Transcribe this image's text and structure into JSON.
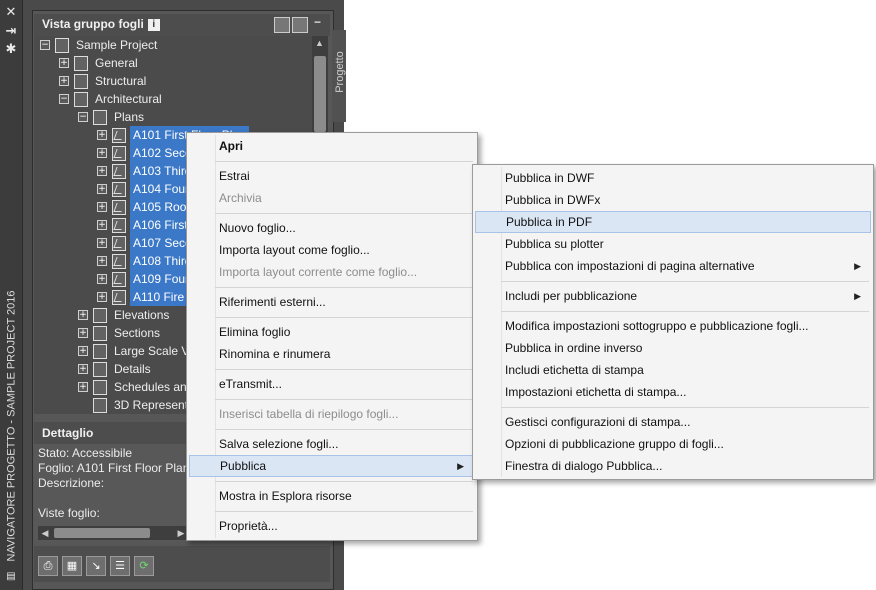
{
  "palette": {
    "vertical_title": "NAVIGATORE PROGETTO - SAMPLE PROJECT 2016",
    "side_tab": "Progetto",
    "title_buttons": [
      "close-icon",
      "autohide-icon",
      "properties-icon"
    ]
  },
  "sheet_set": {
    "header": "Vista gruppo fogli",
    "info_badge": "i",
    "tree": [
      {
        "label": "Sample Project",
        "level": 0,
        "expander": "−",
        "icon": "sheet-set-icon"
      },
      {
        "label": "General",
        "level": 1,
        "expander": "+",
        "icon": "subset-icon"
      },
      {
        "label": "Structural",
        "level": 1,
        "expander": "+",
        "icon": "subset-icon"
      },
      {
        "label": "Architectural",
        "level": 1,
        "expander": "−",
        "icon": "subset-icon"
      },
      {
        "label": "Plans",
        "level": 2,
        "expander": "−",
        "icon": "subset-icon"
      },
      {
        "label": "A101 First Floor Plan",
        "level": 3,
        "expander": "+",
        "icon": "sheet-icon",
        "selected": true
      },
      {
        "label": "A102 Seco",
        "level": 3,
        "expander": "+",
        "icon": "sheet-icon",
        "selected": true
      },
      {
        "label": "A103 Third",
        "level": 3,
        "expander": "+",
        "icon": "sheet-icon",
        "selected": true
      },
      {
        "label": "A104 Four",
        "level": 3,
        "expander": "+",
        "icon": "sheet-icon",
        "selected": true
      },
      {
        "label": "A105 Root",
        "level": 3,
        "expander": "+",
        "icon": "sheet-icon",
        "selected": true
      },
      {
        "label": "A106 First",
        "level": 3,
        "expander": "+",
        "icon": "sheet-icon",
        "selected": true
      },
      {
        "label": "A107 Seco",
        "level": 3,
        "expander": "+",
        "icon": "sheet-icon",
        "selected": true
      },
      {
        "label": "A108 Third",
        "level": 3,
        "expander": "+",
        "icon": "sheet-icon",
        "selected": true
      },
      {
        "label": "A109 Four",
        "level": 3,
        "expander": "+",
        "icon": "sheet-icon",
        "selected": true
      },
      {
        "label": "A110 Fire",
        "level": 3,
        "expander": "+",
        "icon": "sheet-icon",
        "selected": true
      },
      {
        "label": "Elevations",
        "level": 2,
        "expander": "+",
        "icon": "subset-icon"
      },
      {
        "label": "Sections",
        "level": 2,
        "expander": "+",
        "icon": "subset-icon"
      },
      {
        "label": "Large Scale Vi",
        "level": 2,
        "expander": "+",
        "icon": "subset-icon"
      },
      {
        "label": "Details",
        "level": 2,
        "expander": "+",
        "icon": "subset-icon"
      },
      {
        "label": "Schedules and",
        "level": 2,
        "expander": "+",
        "icon": "subset-icon"
      },
      {
        "label": "3D Representa",
        "level": 2,
        "expander": "",
        "icon": "subset-icon"
      }
    ]
  },
  "detail": {
    "header": "Dettaglio",
    "lines": [
      "Stato: Accessibile",
      "Foglio: A101 First Floor Plan",
      "Descrizione:",
      "",
      "Viste foglio:"
    ]
  },
  "bottom_toolbar": [
    "publish-icon",
    "new-sheet-icon",
    "views-icon",
    "list-icon",
    "refresh-icon"
  ],
  "context_menu": {
    "items": [
      {
        "label": "Apri",
        "bold": true
      },
      {
        "sep": true
      },
      {
        "label": "Estrai"
      },
      {
        "label": "Archivia",
        "disabled": true
      },
      {
        "sep": true
      },
      {
        "label": "Nuovo foglio..."
      },
      {
        "label": "Importa layout come foglio..."
      },
      {
        "label": "Importa layout corrente come foglio...",
        "disabled": true
      },
      {
        "sep": true
      },
      {
        "label": "Riferimenti esterni..."
      },
      {
        "sep": true
      },
      {
        "label": "Elimina foglio"
      },
      {
        "label": "Rinomina e rinumera"
      },
      {
        "sep": true
      },
      {
        "label": "eTransmit..."
      },
      {
        "sep": true
      },
      {
        "label": "Inserisci tabella di riepilogo fogli...",
        "disabled": true
      },
      {
        "sep": true
      },
      {
        "label": "Salva selezione fogli..."
      },
      {
        "label": "Pubblica",
        "submenu": true,
        "highlighted": true
      },
      {
        "sep": true
      },
      {
        "label": "Mostra in Esplora risorse"
      },
      {
        "sep": true
      },
      {
        "label": "Proprietà..."
      }
    ]
  },
  "publish_submenu": {
    "items": [
      {
        "label": "Pubblica in DWF"
      },
      {
        "label": "Pubblica in DWFx"
      },
      {
        "label": "Pubblica in PDF",
        "highlighted": true
      },
      {
        "label": "Pubblica su plotter"
      },
      {
        "label": "Pubblica con impostazioni di pagina alternative",
        "submenu": true
      },
      {
        "sep": true
      },
      {
        "label": "Includi per pubblicazione",
        "submenu": true
      },
      {
        "sep": true
      },
      {
        "label": "Modifica impostazioni sottogruppo e pubblicazione fogli..."
      },
      {
        "label": "Pubblica in ordine inverso"
      },
      {
        "label": "Includi etichetta di stampa"
      },
      {
        "label": "Impostazioni etichetta di stampa..."
      },
      {
        "sep": true
      },
      {
        "label": "Gestisci configurazioni di stampa..."
      },
      {
        "label": "Opzioni di pubblicazione gruppo di fogli..."
      },
      {
        "label": "Finestra di dialogo Pubblica..."
      }
    ]
  }
}
